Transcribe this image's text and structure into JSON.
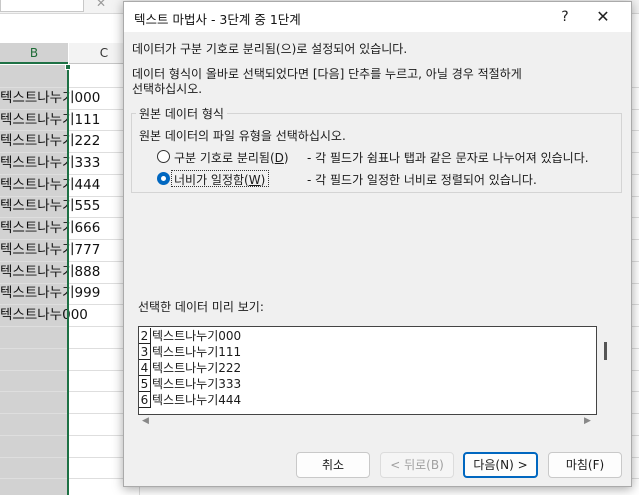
{
  "sheet": {
    "columns": [
      "B",
      "C"
    ],
    "cells": [
      "텍스트나누기000",
      "텍스트나누기111",
      "텍스트나누기222",
      "텍스트나누기333",
      "텍스트나누기444",
      "텍스트나누기555",
      "텍스트나누기666",
      "텍스트나누기777",
      "텍스트나누기888",
      "텍스트나누기999",
      "텍스트나누000"
    ]
  },
  "dialog": {
    "title": "텍스트 마법사 - 3단계 중 1단계",
    "help_label": "?",
    "close_label": "✕",
    "intro": "데이터가 구분 기호로 분리됨(으)로 설정되어 있습니다.",
    "instruction_1": "데이터 형식이 올바로 선택되었다면 [다음] 단추를 누르고, 아닐 경우 적절하게",
    "instruction_2": "선택하십시오.",
    "group_label": "원본 데이터 형식",
    "group_prompt": "원본 데이터의 파일 유형을 선택하십시오.",
    "options": [
      {
        "label": "구분 기호로 분리됨(",
        "key": "D",
        "suffix": ")",
        "desc": "- 각 필드가 쉼표나 탭과 같은 문자로 나누어져 있습니다.",
        "selected": false
      },
      {
        "label": "너비가 일정함(",
        "key": "W",
        "suffix": ")",
        "desc": "- 각 필드가 일정한 너비로 정렬되어 있습니다.",
        "selected": true
      }
    ],
    "preview_label": "선택한 데이터 미리 보기:",
    "preview_rows": [
      {
        "num": "2",
        "text": "텍스트나누기000"
      },
      {
        "num": "3",
        "text": "텍스트나누기111"
      },
      {
        "num": "4",
        "text": "텍스트나누기222"
      },
      {
        "num": "5",
        "text": "텍스트나누기333"
      },
      {
        "num": "6",
        "text": "텍스트나누기444"
      }
    ],
    "buttons": {
      "cancel": "취소",
      "back": "< 뒤로(B)",
      "next": "다음(N) >",
      "finish": "마침(F)"
    }
  }
}
